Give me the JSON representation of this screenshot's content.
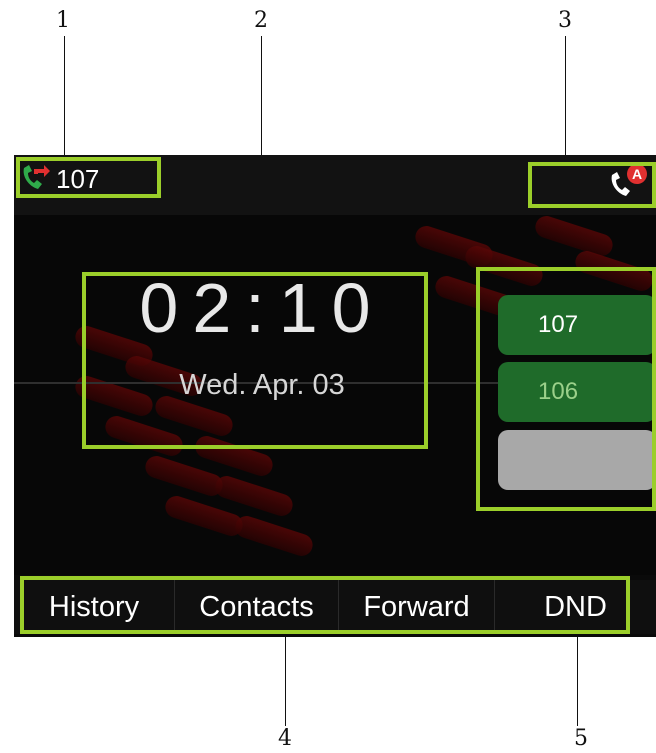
{
  "callouts": [
    "1",
    "2",
    "3",
    "4",
    "5"
  ],
  "status": {
    "line_number": "107"
  },
  "clock": {
    "time": "02:10",
    "date": "Wed. Apr. 03"
  },
  "linekeys": [
    "107",
    "106",
    ""
  ],
  "softkeys": [
    "History",
    "Contacts",
    "Forward",
    "DND"
  ],
  "colors": {
    "highlight": "#9bce2a",
    "linekey_green": "#1f6b2a",
    "linekey_gray": "#a8a8a8",
    "phone_green": "#2faa4a",
    "forward_red": "#e03030"
  },
  "icons": {
    "line_status": "phone-forward-icon",
    "auto_answer": "phone-auto-answer-icon"
  }
}
